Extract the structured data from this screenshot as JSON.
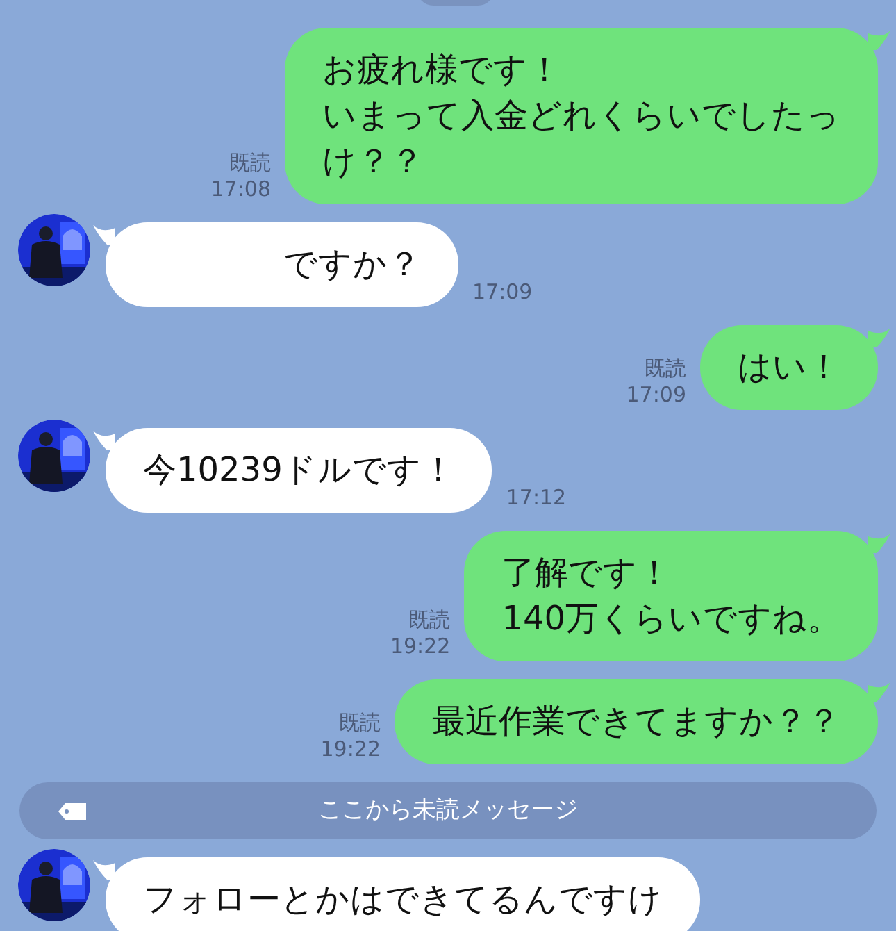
{
  "messages": [
    {
      "kind": "sent",
      "lines": [
        "お疲れ様です！",
        "いまって入金どれくらいでしたっ",
        "け？？"
      ],
      "read": true,
      "read_label": "既読",
      "time": "17:08"
    },
    {
      "kind": "received",
      "lines": [
        "ですか？"
      ],
      "time": "17:09"
    },
    {
      "kind": "sent",
      "lines": [
        "はい！"
      ],
      "read": true,
      "read_label": "既読",
      "time": "17:09"
    },
    {
      "kind": "received",
      "lines": [
        "今10239ドルです！"
      ],
      "time": "17:12"
    },
    {
      "kind": "sent",
      "lines": [
        "了解です！",
        "140万くらいですね。"
      ],
      "read": true,
      "read_label": "既読",
      "time": "19:22"
    },
    {
      "kind": "sent",
      "lines": [
        "最近作業できてますか？？"
      ],
      "read": true,
      "read_label": "既読",
      "time": "19:22"
    },
    {
      "kind": "divider",
      "text": "ここから未読メッセージ"
    },
    {
      "kind": "received",
      "lines": [
        "フォローとかはできてるんですけ"
      ]
    }
  ]
}
